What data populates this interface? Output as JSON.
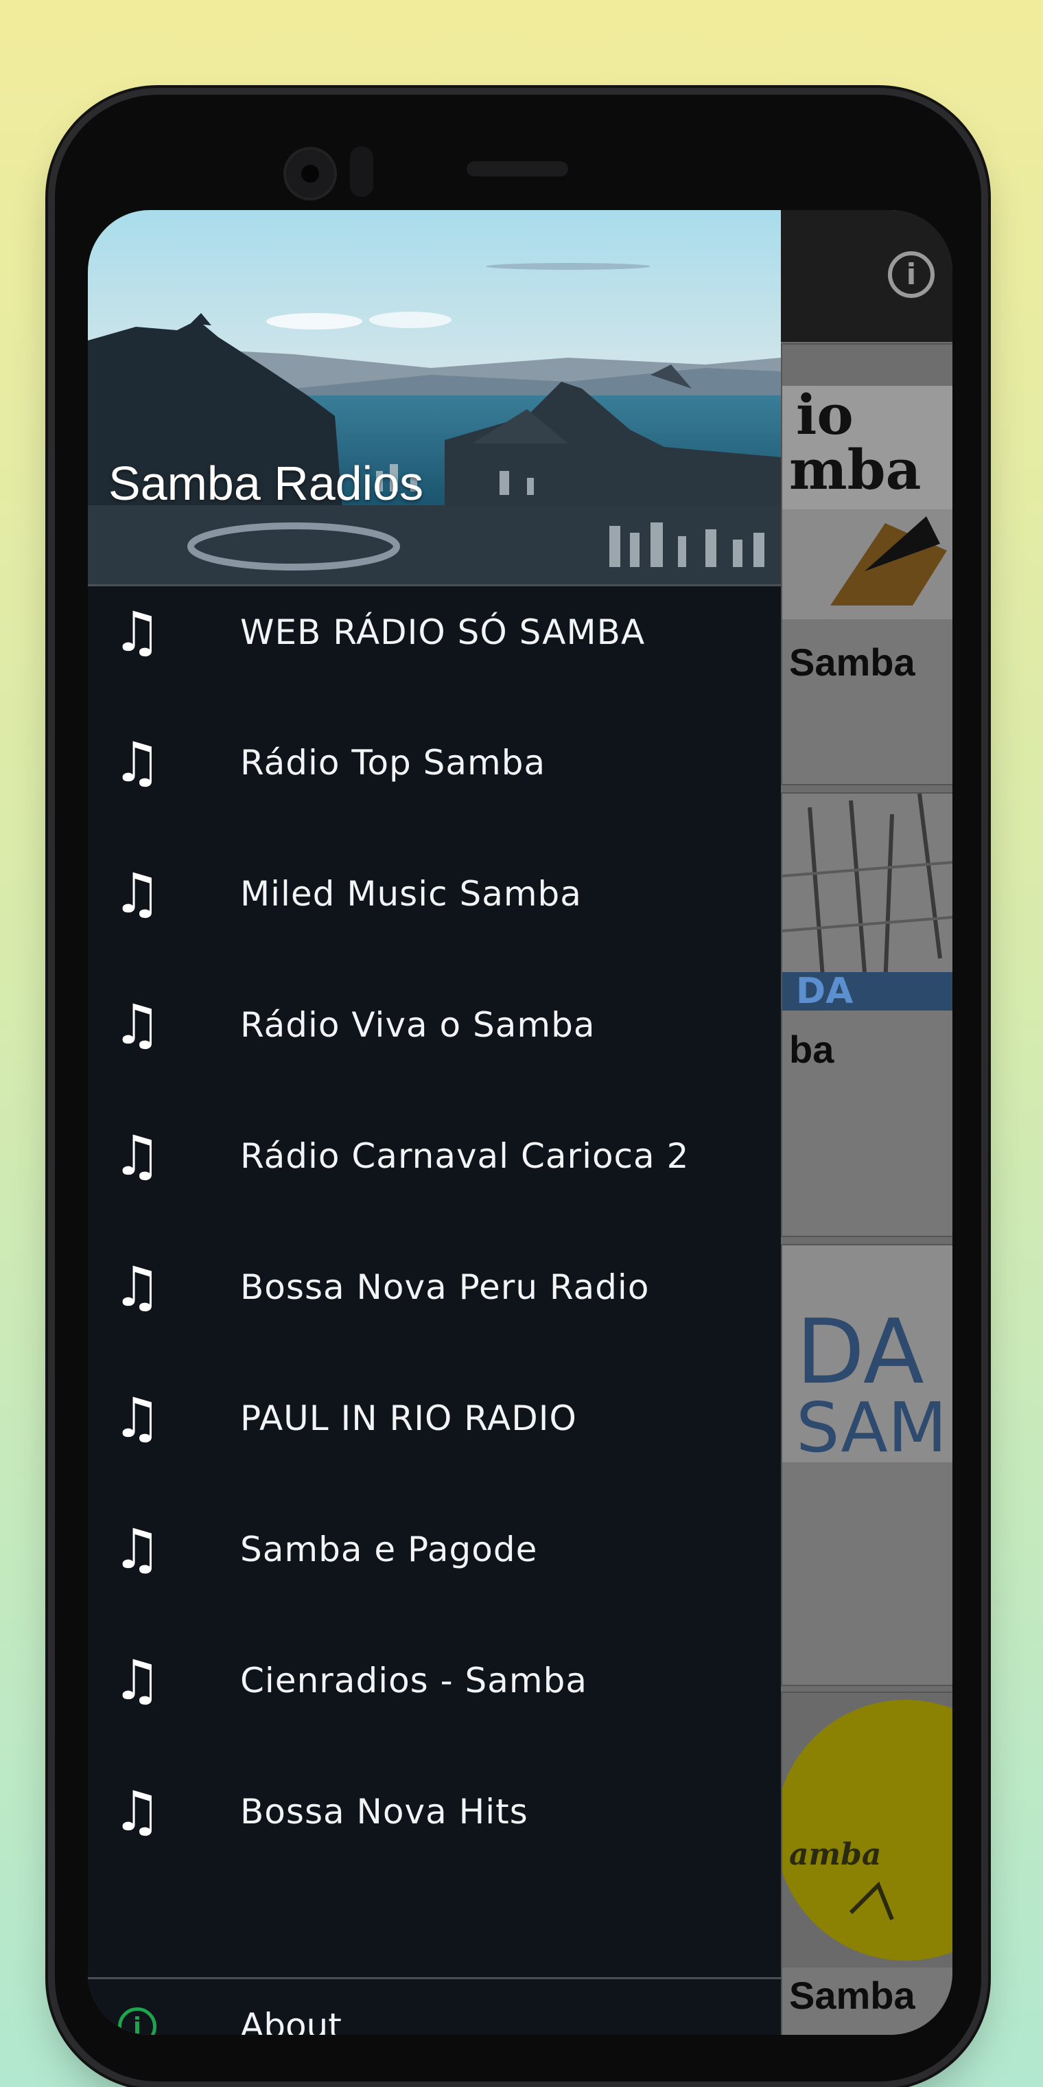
{
  "drawer": {
    "title": "Samba Radios",
    "items": [
      {
        "label": "WEB RÁDIO SÓ SAMBA",
        "icon": "music-note-icon"
      },
      {
        "label": "Rádio Top Samba",
        "icon": "music-note-icon"
      },
      {
        "label": "Miled Music Samba",
        "icon": "music-note-icon"
      },
      {
        "label": "Rádio Viva o Samba",
        "icon": "music-note-icon"
      },
      {
        "label": "Rádio Carnaval Carioca 2",
        "icon": "music-note-icon"
      },
      {
        "label": "Bossa Nova Peru Radio",
        "icon": "music-note-icon"
      },
      {
        "label": "PAUL IN RIO RADIO",
        "icon": "music-note-icon"
      },
      {
        "label": "Samba e Pagode",
        "icon": "music-note-icon"
      },
      {
        "label": "Cienradios - Samba",
        "icon": "music-note-icon"
      },
      {
        "label": "Bossa Nova Hits",
        "icon": "music-note-icon"
      }
    ],
    "about": {
      "label": "About",
      "icon": "info-icon",
      "icon_color": "#1ea44d"
    },
    "note_glyph": "♫",
    "info_glyph": "i"
  },
  "background": {
    "cards": [
      {
        "title": "Samba"
      },
      {
        "title": "ba"
      },
      {
        "title": ""
      },
      {
        "title": "Samba"
      }
    ],
    "info_glyph": "i"
  },
  "colors": {
    "drawer_bg": "#0f131a",
    "page_bg_top": "#f1ec9c",
    "page_bg_bottom": "#b2e8cf"
  }
}
